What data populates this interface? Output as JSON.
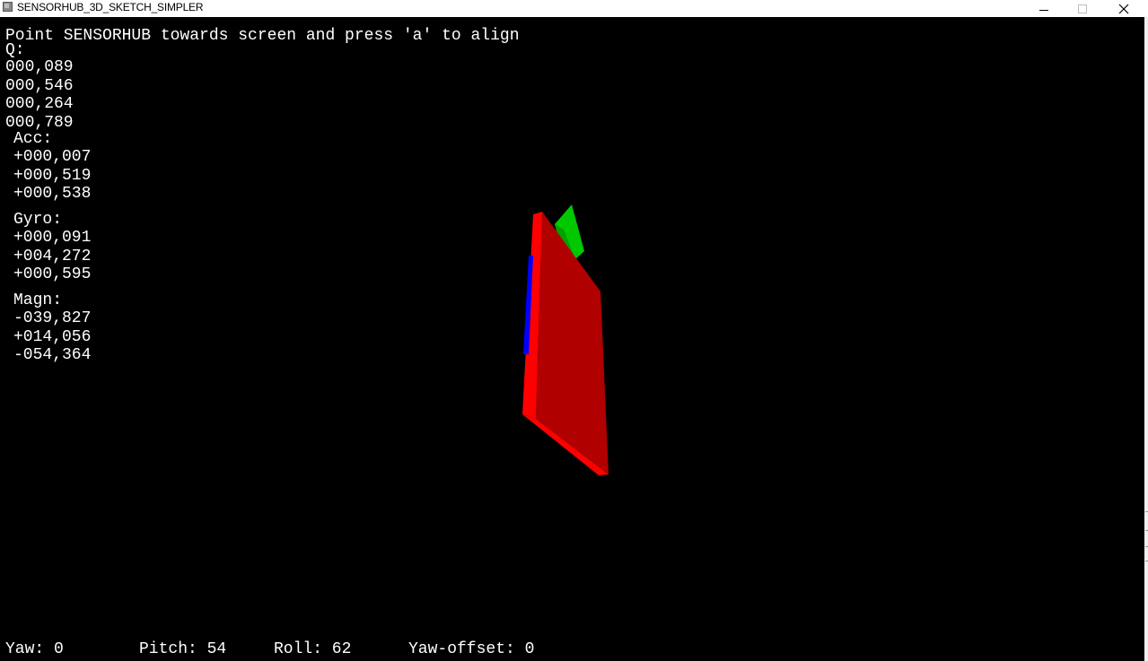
{
  "window": {
    "title": "SENSORHUB_3D_SKETCH_SIMPLER"
  },
  "instructions": "Point SENSORHUB towards screen and press 'a' to align",
  "quaternion": {
    "label": "Q:",
    "values": [
      "000,089",
      "000,546",
      "000,264",
      "000,789"
    ]
  },
  "accelerometer": {
    "label": "Acc:",
    "values": [
      "+000,007",
      "+000,519",
      "+000,538"
    ]
  },
  "gyroscope": {
    "label": "Gyro:",
    "values": [
      "+000,091",
      "+004,272",
      "+000,595"
    ]
  },
  "magnetometer": {
    "label": "Magn:",
    "values": [
      "-039,827",
      "+014,056",
      "-054,364"
    ]
  },
  "status": {
    "yaw": "Yaw: 0",
    "pitch": "Pitch: 54",
    "roll": "Roll: 62",
    "yaw_offset": "Yaw-offset: 0"
  },
  "colors": {
    "background": "#000000",
    "text": "#ffffff",
    "board_face": "#b30000",
    "board_edge": "#ff0000",
    "x_axis_marker": "#0000ff",
    "y_axis_marker": "#00cc00"
  }
}
